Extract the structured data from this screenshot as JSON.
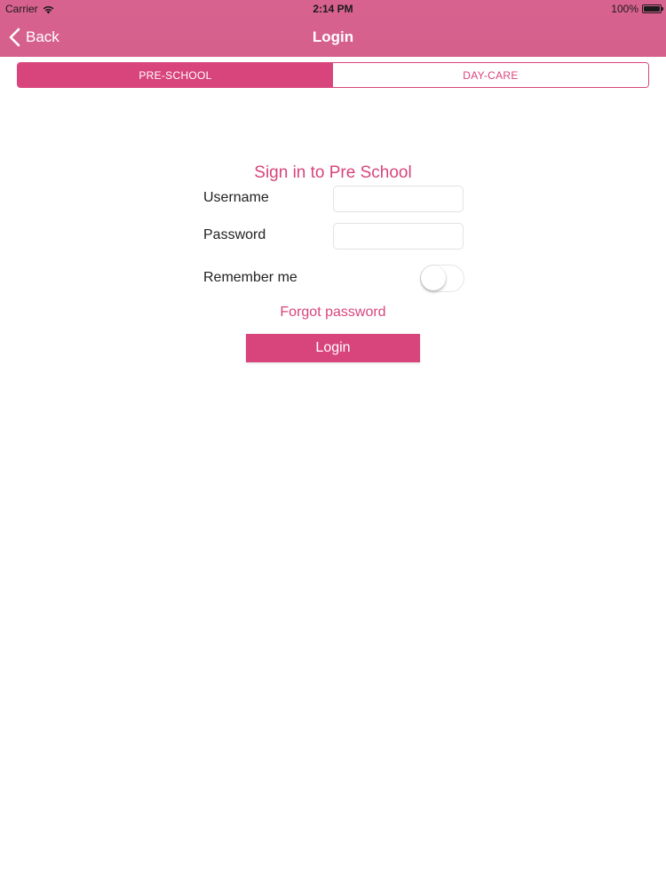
{
  "status_bar": {
    "carrier": "Carrier",
    "time": "2:14 PM",
    "battery": "100%"
  },
  "nav": {
    "back_label": "Back",
    "title": "Login"
  },
  "segments": {
    "items": [
      {
        "label": "PRE-SCHOOL",
        "selected": true
      },
      {
        "label": "DAY-CARE",
        "selected": false
      }
    ]
  },
  "form": {
    "title": "Sign in to Pre School",
    "username_label": "Username",
    "username_value": "",
    "password_label": "Password",
    "password_value": "",
    "remember_label": "Remember me",
    "remember_on": false,
    "forgot_label": "Forgot password",
    "login_label": "Login"
  },
  "colors": {
    "accent": "#d8457c",
    "header": "#d8628f"
  }
}
